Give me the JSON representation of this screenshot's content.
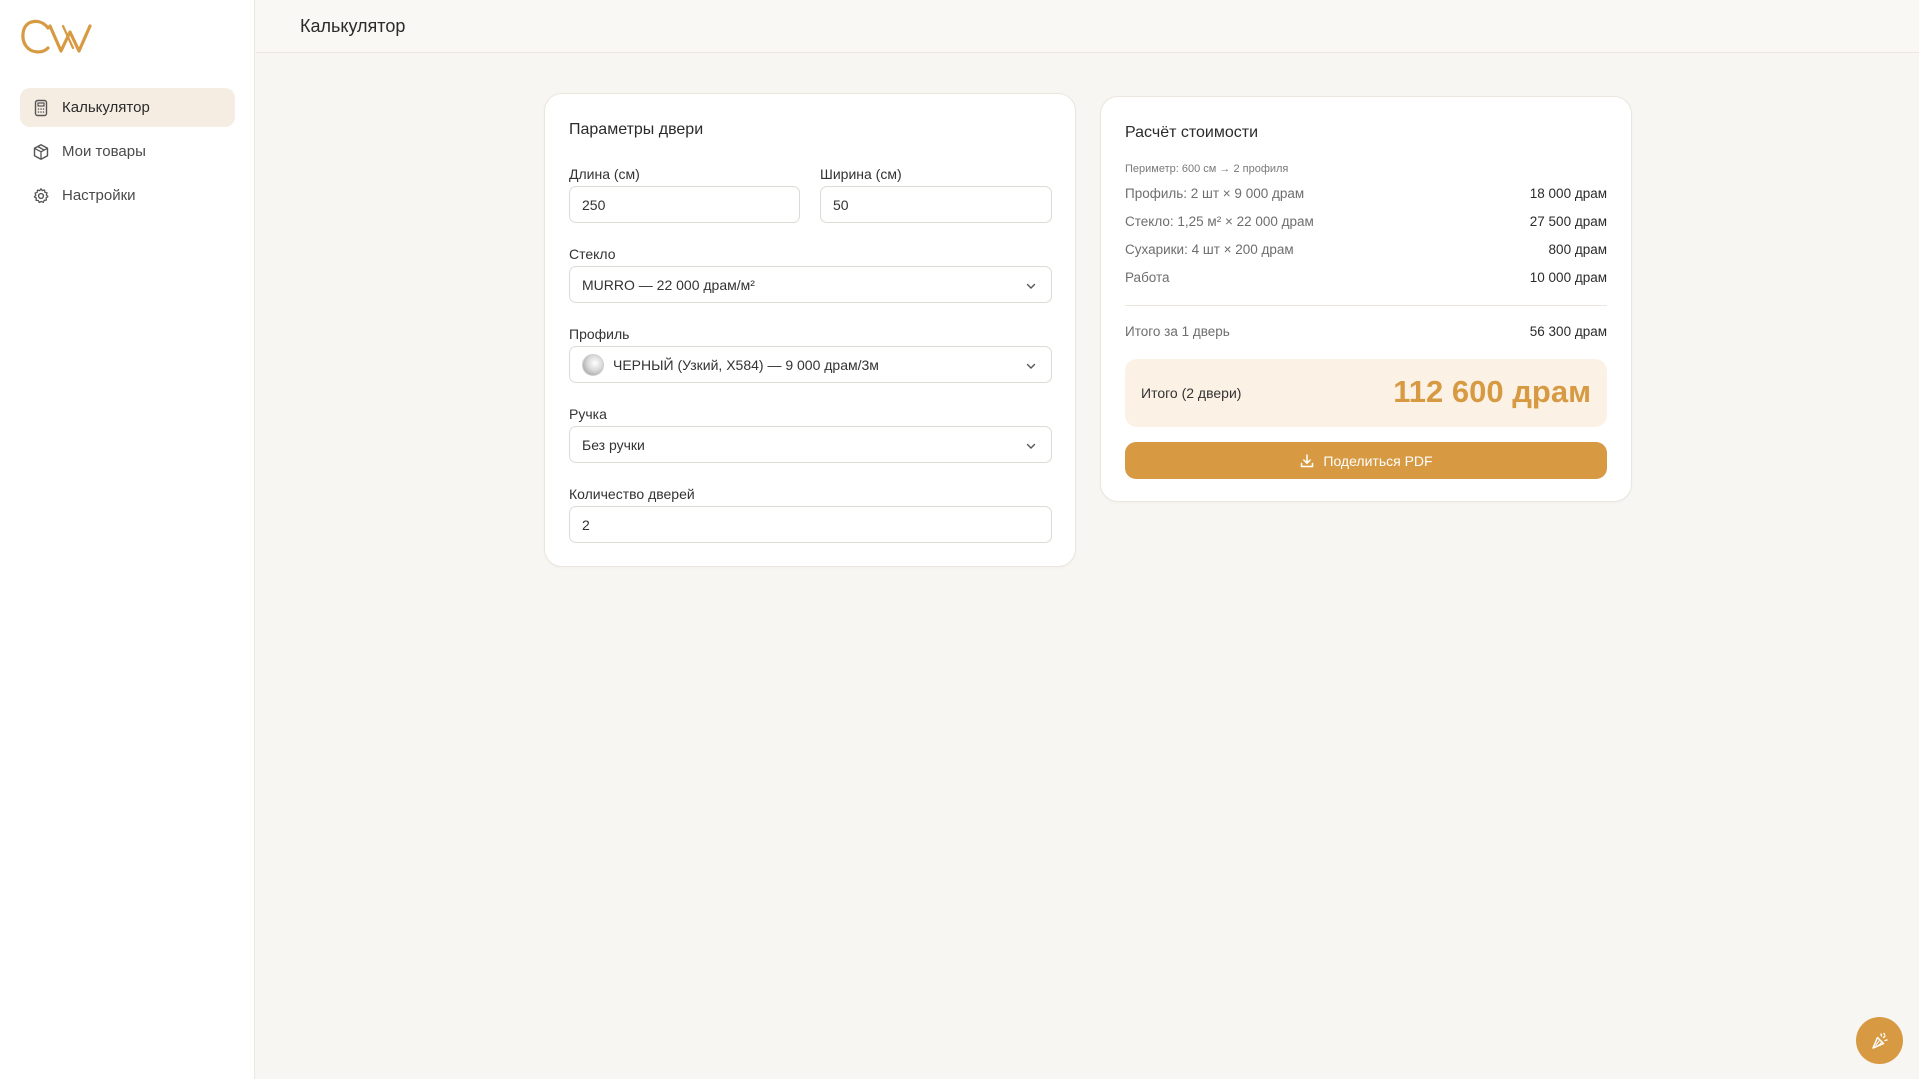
{
  "app": {
    "logo_text": "CW",
    "accent": "#d79a43"
  },
  "sidebar": {
    "items": [
      {
        "label": "Калькулятор",
        "icon": "calculator-icon",
        "active": true
      },
      {
        "label": "Мои товары",
        "icon": "box-icon",
        "active": false
      },
      {
        "label": "Настройки",
        "icon": "gear-icon",
        "active": false
      }
    ]
  },
  "header": {
    "title": "Калькулятор"
  },
  "params": {
    "title": "Параметры двери",
    "length_label": "Длина (см)",
    "length_value": "250",
    "width_label": "Ширина (см)",
    "width_value": "50",
    "glass_label": "Стекло",
    "glass_value": "MURRO — 22 000 драм/м²",
    "profile_label": "Профиль",
    "profile_value": "ЧЕРНЫЙ (Узкий, X584) — 9 000 драм/3м",
    "handle_label": "Ручка",
    "handle_value": "Без ручки",
    "qty_label": "Количество дверей",
    "qty_value": "2"
  },
  "cost": {
    "title": "Расчёт стоимости",
    "perimeter_note": "Периметр: 600 см → 2 профиля",
    "lines": [
      {
        "label": "Профиль: 2 шт × 9 000 драм",
        "value": "18 000 драм"
      },
      {
        "label": "Стекло: 1,25 м² × 22 000 драм",
        "value": "27 500 драм"
      },
      {
        "label": "Сухарики: 4 шт × 200 драм",
        "value": "800 драм"
      },
      {
        "label": "Работа",
        "value": "10 000 драм"
      }
    ],
    "per_door_label": "Итого за 1 дверь",
    "per_door_value": "56 300 драм",
    "total_label": "Итого (2 двери)",
    "total_value": "112 600 драм",
    "pdf_button": "Поделиться PDF"
  },
  "fab": {
    "icon": "party-popper-icon"
  }
}
